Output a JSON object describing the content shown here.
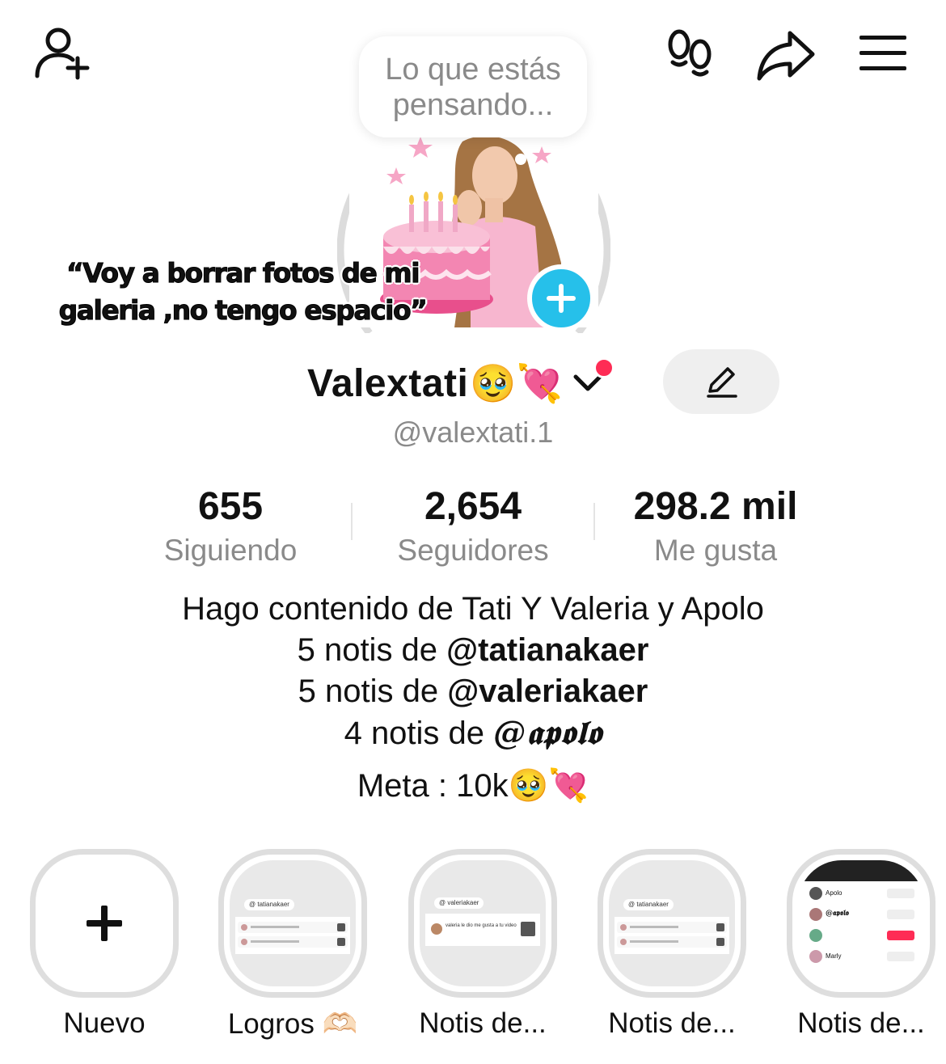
{
  "topbar": {
    "add_friend_icon": "person-add-icon",
    "footprints_icon": "footprints-icon",
    "share_icon": "share-arrow-icon",
    "menu_icon": "hamburger-menu-icon"
  },
  "thought_bubble": {
    "text": "Lo que estás pensando..."
  },
  "avatar": {
    "overlay_text": "“Voy a borrar fotos de mi galeria ,no tengo espacio”"
  },
  "profile": {
    "display_name": "Valextati",
    "name_emojis": "🥹💘",
    "handle": "@valextati.1"
  },
  "stats": [
    {
      "value": "655",
      "label": "Siguiendo"
    },
    {
      "value": "2,654",
      "label": "Seguidores"
    },
    {
      "value": "298.2 mil",
      "label": "Me gusta"
    }
  ],
  "bio": {
    "line1": "Hago contenido de Tati  Y Valeria y Apolo",
    "line2_prefix": "5 notis de ",
    "line2_mention": "@tatianakaer",
    "line3_prefix": "5 notis de ",
    "line3_mention": "@valeriakaer",
    "line4_prefix": "4 notis de ",
    "line4_mention": "@𝖆𝖕𝖔𝖑𝖔",
    "goal": "Meta : 10k🥹💘"
  },
  "highlights": [
    {
      "label": "Nuevo"
    },
    {
      "label": "Logros 🫶🏻",
      "tag": "@ tatianakaer"
    },
    {
      "label": "Notis de...",
      "tag": "@ valeriakaer",
      "row_text": "valeria le dio me gusta a tu video"
    },
    {
      "label": "Notis de...",
      "tag": "@ tatianakaer"
    },
    {
      "label": "Notis de...",
      "rows": [
        "Apolo",
        "@𝖆𝖕𝖔𝖑𝖔",
        "",
        "Marly"
      ]
    }
  ],
  "colors": {
    "accent_blue": "#26c0ea",
    "notif_red": "#fe2c55",
    "secondary_text": "#8a8a8a",
    "cake_pink": "#f06aa0"
  }
}
